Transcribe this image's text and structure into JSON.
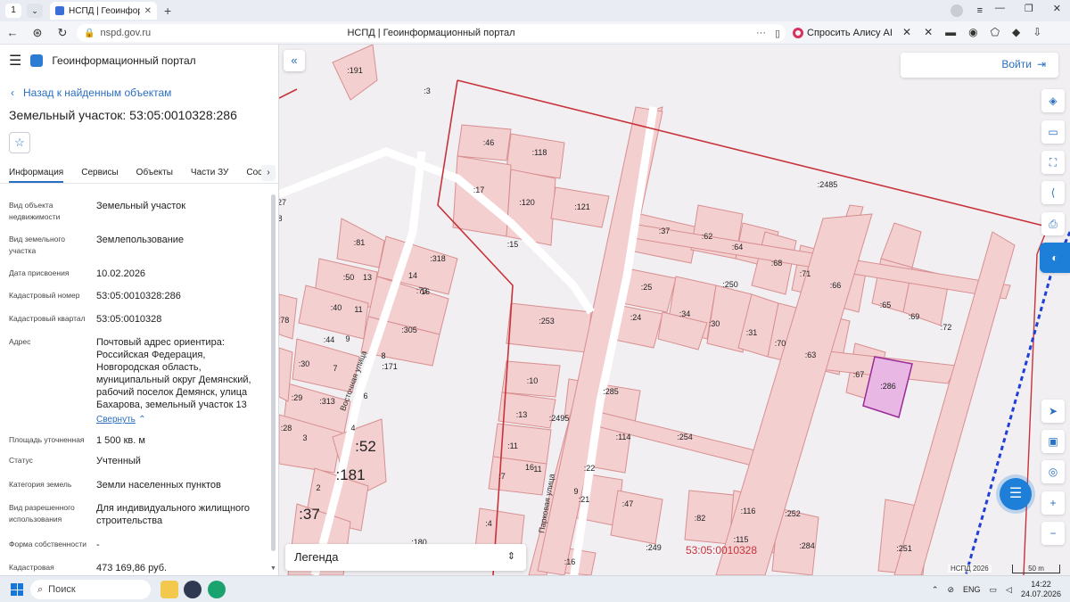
{
  "browser": {
    "tab_count": "1",
    "tab_title": "НСПД | Геоинформационный п",
    "url": "nspd.gov.ru",
    "page_title": "НСПД | Геоинформационный портал",
    "alice_label": "Спросить Алису AI"
  },
  "panel": {
    "portal_name": "Геоинформационный портал",
    "back_label": "Назад к найденным объектам",
    "object_title": "Земельный участок: 53:05:0010328:286",
    "tabs": [
      "Информация",
      "Сервисы",
      "Объекты",
      "Части ЗУ",
      "Состав"
    ],
    "properties": [
      {
        "key": "Вид объекта недвижимости",
        "value": "Земельный участок"
      },
      {
        "key": "Вид земельного участка",
        "value": "Землепользование"
      },
      {
        "key": "Дата присвоения",
        "value": "10.02.2026"
      },
      {
        "key": "Кадастровый номер",
        "value": "53:05:0010328:286"
      },
      {
        "key": "Кадастровый квартал",
        "value": "53:05:0010328"
      },
      {
        "key": "Адрес",
        "value": "Почтовый адрес ориентира: Российская Федерация, Новгородская область, муниципальный округ Демянский, рабочий поселок Демянск, улица Бахарова, земельный участок 13"
      },
      {
        "key": "Площадь уточненная",
        "value": "1 500 кв. м"
      },
      {
        "key": "Статус",
        "value": "Учтенный"
      },
      {
        "key": "Категория земель",
        "value": "Земли населенных пунктов"
      },
      {
        "key": "Вид разрешенного использования",
        "value": "Для индивидуального жилищного строительства"
      },
      {
        "key": "Форма собственности",
        "value": "-"
      },
      {
        "key": "Кадастровая",
        "value": "473 169,86 руб."
      }
    ],
    "collapse_label": "Свернуть"
  },
  "map": {
    "login_label": "Войти",
    "legend_label": "Легенда",
    "quarter_label": "53:05:0010328",
    "attribution": "НСПД 2026",
    "scale_label": "50 m",
    "streets": [
      "Восточная улица",
      "Парковая улица"
    ],
    "selected_plot": ":286",
    "plot_labels": [
      ":191",
      ":3",
      ":46",
      ":118",
      ":17",
      ":120",
      ":121",
      ":15",
      ":2485",
      ":37",
      ":62",
      ":64",
      ":68",
      ":71",
      ":66",
      ":25",
      ":250",
      ":65",
      ":69",
      ":72",
      ":24",
      ":34",
      ":30",
      ":31",
      ":70",
      ":63",
      ":67",
      ":81",
      ":318",
      ":50",
      ":73",
      ":40",
      ":44",
      ":305",
      ":30",
      ":171",
      ":29",
      ":313",
      ":28",
      ":253",
      ":10",
      ":285",
      ":13",
      ":2495",
      ":114",
      ":254",
      ":11",
      ":22",
      ":7",
      ":21",
      ":47",
      ":82",
      ":116",
      ":252",
      ":4",
      ":180",
      ":115",
      ":284",
      ":249",
      ":16",
      ":251",
      ":78",
      "27",
      "8",
      "13",
      "11",
      "9",
      "7",
      "14",
      "16",
      "8",
      "6",
      "4",
      "3",
      "2",
      "11",
      "16",
      "9"
    ],
    "big_labels": [
      ":52",
      ":181",
      ":37"
    ]
  },
  "taskbar": {
    "search_placeholder": "Поиск",
    "lang": "ENG",
    "time": "14:22",
    "date": "24.07.2026"
  },
  "colors": {
    "accent": "#1e7fd8",
    "parcel_fill": "#f3cfd0",
    "parcel_stroke": "#d88f90",
    "boundary": "#c8323a",
    "selected_fill": "#e8b7e4",
    "selected_stroke": "#9a2a9a"
  }
}
